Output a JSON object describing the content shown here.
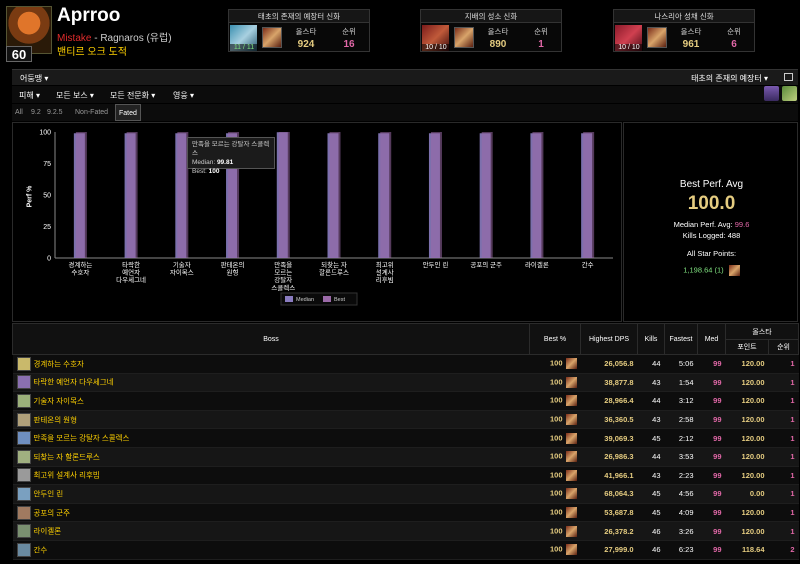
{
  "player": {
    "name": "Aprroo",
    "level": "60",
    "guild": "Mistake",
    "realm": " - Ragnaros (유럽)",
    "spec_class": "밴티르 오크 도적"
  },
  "raid_cards": [
    {
      "title": "태초의 존재의 예장터 신화",
      "count": "11 / 11",
      "col1_label": "올스타",
      "col1_value": "924",
      "col2_label": "순위",
      "col2_value": "16"
    },
    {
      "title": "지배의 성소 신화",
      "count": "10 / 10",
      "col1_label": "올스타",
      "col1_value": "890",
      "col2_label": "순위",
      "col2_value": "1"
    },
    {
      "title": "나스리아 성채 신화",
      "count": "10 / 10",
      "col1_label": "올스타",
      "col1_value": "961",
      "col2_label": "순위",
      "col2_value": "6"
    }
  ],
  "toolbar": {
    "metric": "어둠땡",
    "zone": "태초의 존재의 예장터",
    "menus": [
      "피해",
      "모든 보스",
      "모든 전문화",
      "영웅"
    ],
    "tabs": [
      "All",
      "9.2",
      "9.2.5",
      "Non-Fated",
      "Fated"
    ]
  },
  "tooltip": {
    "title": "만족을 모르는 강탈자 스콜렉스",
    "median_label": "Median:",
    "median_value": "99.81",
    "best_label": "Best:",
    "best_value": "100"
  },
  "chart_data": {
    "type": "bar",
    "ylabel": "Perf %",
    "ylim": [
      0,
      100
    ],
    "yticks": [
      "0",
      "25",
      "50",
      "75",
      "100"
    ],
    "categories": [
      [
        "경계하는",
        "수호자"
      ],
      [
        "타락한",
        "예언자",
        "다우세그네"
      ],
      [
        "기술자",
        "자이목스"
      ],
      [
        "판테온의",
        "원형"
      ],
      [
        "만족을",
        "모르는",
        "강탈자",
        "스콜렉스"
      ],
      [
        "되찾는 자",
        "할론드루스"
      ],
      [
        "최고위",
        "설계사",
        "리후빔"
      ],
      [
        "안두인 린"
      ],
      [
        "공포의 군주"
      ],
      [
        "라이겔론"
      ],
      [
        "간수"
      ]
    ],
    "series": [
      {
        "name": "Median",
        "values": [
          99,
          99,
          99,
          99,
          99.81,
          99,
          99,
          99,
          99,
          99,
          99
        ],
        "color": "#8a7cc0"
      },
      {
        "name": "Best",
        "values": [
          100,
          100,
          100,
          100,
          100,
          100,
          100,
          100,
          100,
          100,
          100
        ],
        "color": "#9b6aa8"
      }
    ],
    "legend": "bottom-center"
  },
  "stats": {
    "title": "Best Perf. Avg",
    "value": "100.0",
    "median_label": "Median Perf. Avg:",
    "median_value": "99.6",
    "kills_label": "Kills Logged:",
    "kills_value": "488",
    "allstar_label": "All Star Points:",
    "allstar_value": "1,198.64 (1)"
  },
  "table": {
    "headers": {
      "boss": "Boss",
      "best": "Best %",
      "dps": "Highest DPS",
      "kills": "Kills",
      "fastest": "Fastest",
      "med": "Med",
      "allstar": "올스타",
      "points": "포인트",
      "rank": "순위"
    },
    "rows": [
      {
        "boss": "경계하는 수호자",
        "best": "100",
        "dps": "26,056.8",
        "kills": "44",
        "fastest": "5:06",
        "med": "99",
        "points": "120.00",
        "rank": "1",
        "icon": "#c9b96b"
      },
      {
        "boss": "타락한 예언자 다우세그네",
        "best": "100",
        "dps": "38,877.8",
        "kills": "43",
        "fastest": "1:54",
        "med": "99",
        "points": "120.00",
        "rank": "1",
        "icon": "#8a6fb0"
      },
      {
        "boss": "기술자 자이목스",
        "best": "100",
        "dps": "28,966.4",
        "kills": "44",
        "fastest": "3:12",
        "med": "99",
        "points": "120.00",
        "rank": "1",
        "icon": "#9bb07a"
      },
      {
        "boss": "판테온의 원형",
        "best": "100",
        "dps": "36,360.5",
        "kills": "43",
        "fastest": "2:58",
        "med": "99",
        "points": "120.00",
        "rank": "1",
        "icon": "#b0a07a"
      },
      {
        "boss": "만족을 모르는 강탈자 스콜렉스",
        "best": "100",
        "dps": "39,069.3",
        "kills": "45",
        "fastest": "2:12",
        "med": "99",
        "points": "120.00",
        "rank": "1",
        "icon": "#6f8fc0"
      },
      {
        "boss": "되찾는 자 할론드루스",
        "best": "100",
        "dps": "26,986.3",
        "kills": "44",
        "fastest": "3:53",
        "med": "99",
        "points": "120.00",
        "rank": "1",
        "icon": "#a0b080"
      },
      {
        "boss": "최고위 설계사 리후빔",
        "best": "100",
        "dps": "41,966.1",
        "kills": "43",
        "fastest": "2:23",
        "med": "99",
        "points": "120.00",
        "rank": "1",
        "icon": "#9a9a9a"
      },
      {
        "boss": "안두인 린",
        "best": "100",
        "dps": "68,064.3",
        "kills": "45",
        "fastest": "4:56",
        "med": "99",
        "points": "0.00",
        "rank": "1",
        "icon": "#7aa0c0"
      },
      {
        "boss": "공포의 군주",
        "best": "100",
        "dps": "53,687.8",
        "kills": "45",
        "fastest": "4:09",
        "med": "99",
        "points": "120.00",
        "rank": "1",
        "icon": "#a07a60"
      },
      {
        "boss": "라이겔론",
        "best": "100",
        "dps": "26,378.2",
        "kills": "46",
        "fastest": "3:26",
        "med": "99",
        "points": "120.00",
        "rank": "1",
        "icon": "#7a9070"
      },
      {
        "boss": "간수",
        "best": "100",
        "dps": "27,999.0",
        "kills": "46",
        "fastest": "6:23",
        "med": "99",
        "points": "118.64",
        "rank": "2",
        "icon": "#6a8aa0"
      }
    ]
  },
  "colors": {
    "gold": "#e5cc80",
    "pink": "#e268a8",
    "boss_name": "#ffd100",
    "guild": "#e02b2b"
  }
}
